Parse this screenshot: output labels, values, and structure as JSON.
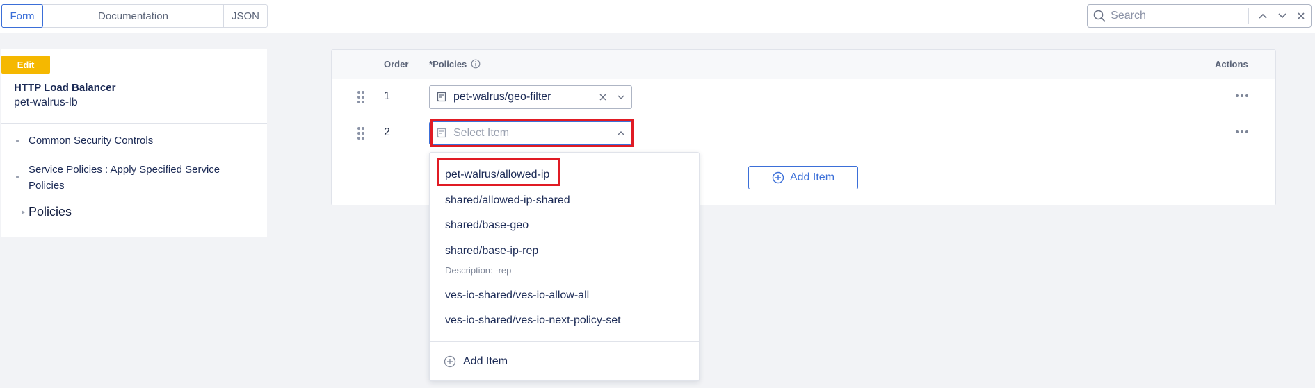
{
  "top_tabs": {
    "form": "Form",
    "documentation": "Documentation",
    "json": "JSON"
  },
  "search": {
    "placeholder": "Search"
  },
  "left_panel": {
    "badge": "Edit",
    "object_type": "HTTP Load Balancer",
    "object_name": "pet-walrus-lb",
    "tree": [
      {
        "label": "Common Security Controls"
      },
      {
        "label": "Service Policies : Apply Specified Service Policies"
      },
      {
        "label": "Policies"
      }
    ]
  },
  "table": {
    "headers": {
      "order": "Order",
      "policies": "*Policies",
      "actions": "Actions"
    },
    "rows": [
      {
        "order": "1",
        "value": "pet-walrus/geo-filter"
      },
      {
        "order": "2",
        "placeholder": "Select Item"
      }
    ],
    "add_item_label": "Add Item"
  },
  "dropdown": {
    "options": [
      {
        "label": "pet-walrus/allowed-ip"
      },
      {
        "label": "shared/allowed-ip-shared"
      },
      {
        "label": "shared/base-geo"
      },
      {
        "label": "shared/base-ip-rep",
        "description": "Description: -rep"
      },
      {
        "label": "ves-io-shared/ves-io-allow-all"
      },
      {
        "label": "ves-io-shared/ves-io-next-policy-set"
      }
    ],
    "add_item_label": "Add Item"
  },
  "colors": {
    "accent": "#3b6fd8",
    "badge": "#f5b800",
    "highlight": "#e01b24"
  }
}
